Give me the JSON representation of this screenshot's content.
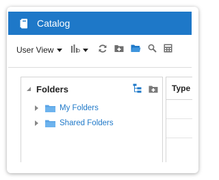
{
  "window": {
    "title": "Catalog",
    "accent_color": "#1e78c8",
    "title_icon": "catalog-book-icon"
  },
  "toolbar": {
    "view_label": "User View",
    "icons": [
      "bar-chart-icon",
      "refresh-icon",
      "new-folder-icon",
      "open-folder-icon",
      "search-icon",
      "calculator-icon"
    ]
  },
  "folders_panel": {
    "title": "Folders",
    "header_icons": [
      "tree-structure-icon",
      "new-folder-icon"
    ],
    "items": [
      {
        "label": "My Folders",
        "icon": "folder-icon"
      },
      {
        "label": "Shared Folders",
        "icon": "folder-icon"
      }
    ]
  },
  "details_panel": {
    "column_header": "Type"
  }
}
